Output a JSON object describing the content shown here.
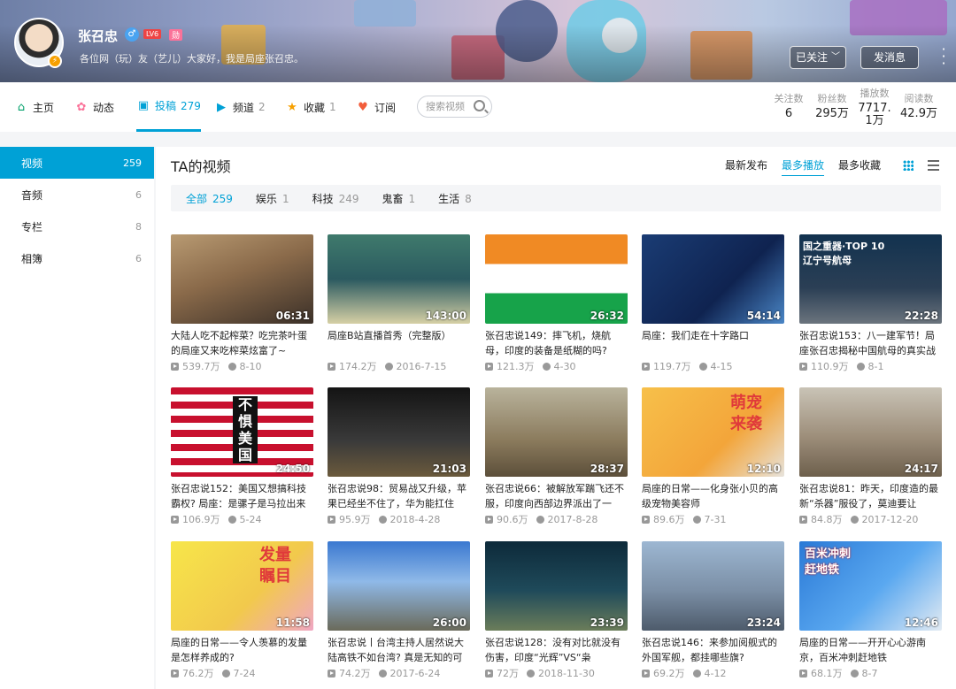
{
  "profile": {
    "name": "张召忠",
    "gender_symbol": "♂",
    "level_badge": "LV6",
    "vip_badge": "勋",
    "sign": "各位网（玩）友（艺儿）大家好，我是局座张召忠。",
    "followed_label": "已关注",
    "message_label": "发消息"
  },
  "nav": {
    "items": [
      {
        "label": "主页",
        "count": "",
        "icon": "home-icon",
        "color": "#00a06a"
      },
      {
        "label": "动态",
        "count": "",
        "icon": "dynamic-icon",
        "color": "#fb7299"
      },
      {
        "label": "投稿",
        "count": "279",
        "icon": "upload-icon",
        "color": "#00a1d6"
      },
      {
        "label": "频道",
        "count": "2",
        "icon": "channel-icon",
        "color": "#00a1d6"
      },
      {
        "label": "收藏",
        "count": "1",
        "icon": "favorite-icon",
        "color": "#f7a000"
      },
      {
        "label": "订阅",
        "count": "",
        "icon": "subscribe-icon",
        "color": "#f25d3b"
      }
    ],
    "search_placeholder": "搜索视频",
    "stats": [
      {
        "label": "关注数",
        "value": "6"
      },
      {
        "label": "粉丝数",
        "value": "295万"
      },
      {
        "label": "播放数",
        "value": "7717.1万"
      },
      {
        "label": "阅读数",
        "value": "42.9万"
      }
    ]
  },
  "sidebar": {
    "items": [
      {
        "label": "视频",
        "count": "259"
      },
      {
        "label": "音频",
        "count": "6"
      },
      {
        "label": "专栏",
        "count": "8"
      },
      {
        "label": "相簿",
        "count": "6"
      }
    ]
  },
  "main": {
    "title": "TA的视频",
    "sorts": [
      "最新发布",
      "最多播放",
      "最多收藏"
    ],
    "active_sort": "最多播放",
    "categories": [
      {
        "label": "全部",
        "count": "259"
      },
      {
        "label": "娱乐",
        "count": "1"
      },
      {
        "label": "科技",
        "count": "249"
      },
      {
        "label": "鬼畜",
        "count": "1"
      },
      {
        "label": "生活",
        "count": "8"
      }
    ],
    "videos": [
      {
        "duration": "06:31",
        "title": "大陆人吃不起榨菜？吃完茶叶蛋的局座又来吃榨菜炫富了~",
        "plays": "539.7万",
        "date": "8-10",
        "overlay": ""
      },
      {
        "duration": "143:00",
        "title": "局座B站直播首秀（完整版）",
        "plays": "174.2万",
        "date": "2016-7-15",
        "overlay": ""
      },
      {
        "duration": "26:32",
        "title": "张召忠说149：摔飞机，烧航母，印度的装备是纸糊的吗?",
        "plays": "121.3万",
        "date": "4-30",
        "overlay": ""
      },
      {
        "duration": "54:14",
        "title": "局座：我们走在十字路口",
        "plays": "119.7万",
        "date": "4-15",
        "overlay": ""
      },
      {
        "duration": "22:28",
        "title": "张召忠说153：八一建军节！局座张召忠揭秘中国航母的真实战",
        "plays": "110.9万",
        "date": "8-1",
        "overlay": "国之重器·TOP 10\n辽宁号航母"
      },
      {
        "duration": "24:50",
        "title": "张召忠说152：美国又想搞科技霸权? 局座：是骡子是马拉出来",
        "plays": "106.9万",
        "date": "5-24",
        "overlay": "不\n惧\n美\n国"
      },
      {
        "duration": "21:03",
        "title": "张召忠说98：贸易战又升级，苹果已经坐不住了，华为能扛住",
        "plays": "95.9万",
        "date": "2018-4-28",
        "overlay": ""
      },
      {
        "duration": "28:37",
        "title": "张召忠说66：被解放军踹飞还不服，印度向西部边界派出了一",
        "plays": "90.6万",
        "date": "2017-8-28",
        "overlay": ""
      },
      {
        "duration": "12:10",
        "title": "局座的日常——化身张小贝的高级宠物美容师",
        "plays": "89.6万",
        "date": "7-31",
        "overlay": "萌宠\n来袭"
      },
      {
        "duration": "24:17",
        "title": "张召忠说81：昨天，印度造的最新“杀器”服役了，莫迪要让",
        "plays": "84.8万",
        "date": "2017-12-20",
        "overlay": ""
      },
      {
        "duration": "11:58",
        "title": "局座的日常——令人羡慕的发量是怎样养成的?",
        "plays": "76.2万",
        "date": "7-24",
        "overlay": "发量\n瞩目"
      },
      {
        "duration": "26:00",
        "title": "张召忠说丨台湾主持人居然说大陆高铁不如台湾? 真是无知的可",
        "plays": "74.2万",
        "date": "2017-6-24",
        "overlay": ""
      },
      {
        "duration": "23:39",
        "title": "张召忠说128：没有对比就没有伤害，印度“光辉”VS“枭",
        "plays": "72万",
        "date": "2018-11-30",
        "overlay": ""
      },
      {
        "duration": "23:24",
        "title": "张召忠说146：来参加阅舰式的外国军舰，都挂哪些旗?",
        "plays": "69.2万",
        "date": "4-12",
        "overlay": ""
      },
      {
        "duration": "12:46",
        "title": "局座的日常——开开心心游南京，百米冲刺赶地铁",
        "plays": "68.1万",
        "date": "8-7",
        "overlay": "百米冲刺\n赶地铁"
      }
    ]
  }
}
